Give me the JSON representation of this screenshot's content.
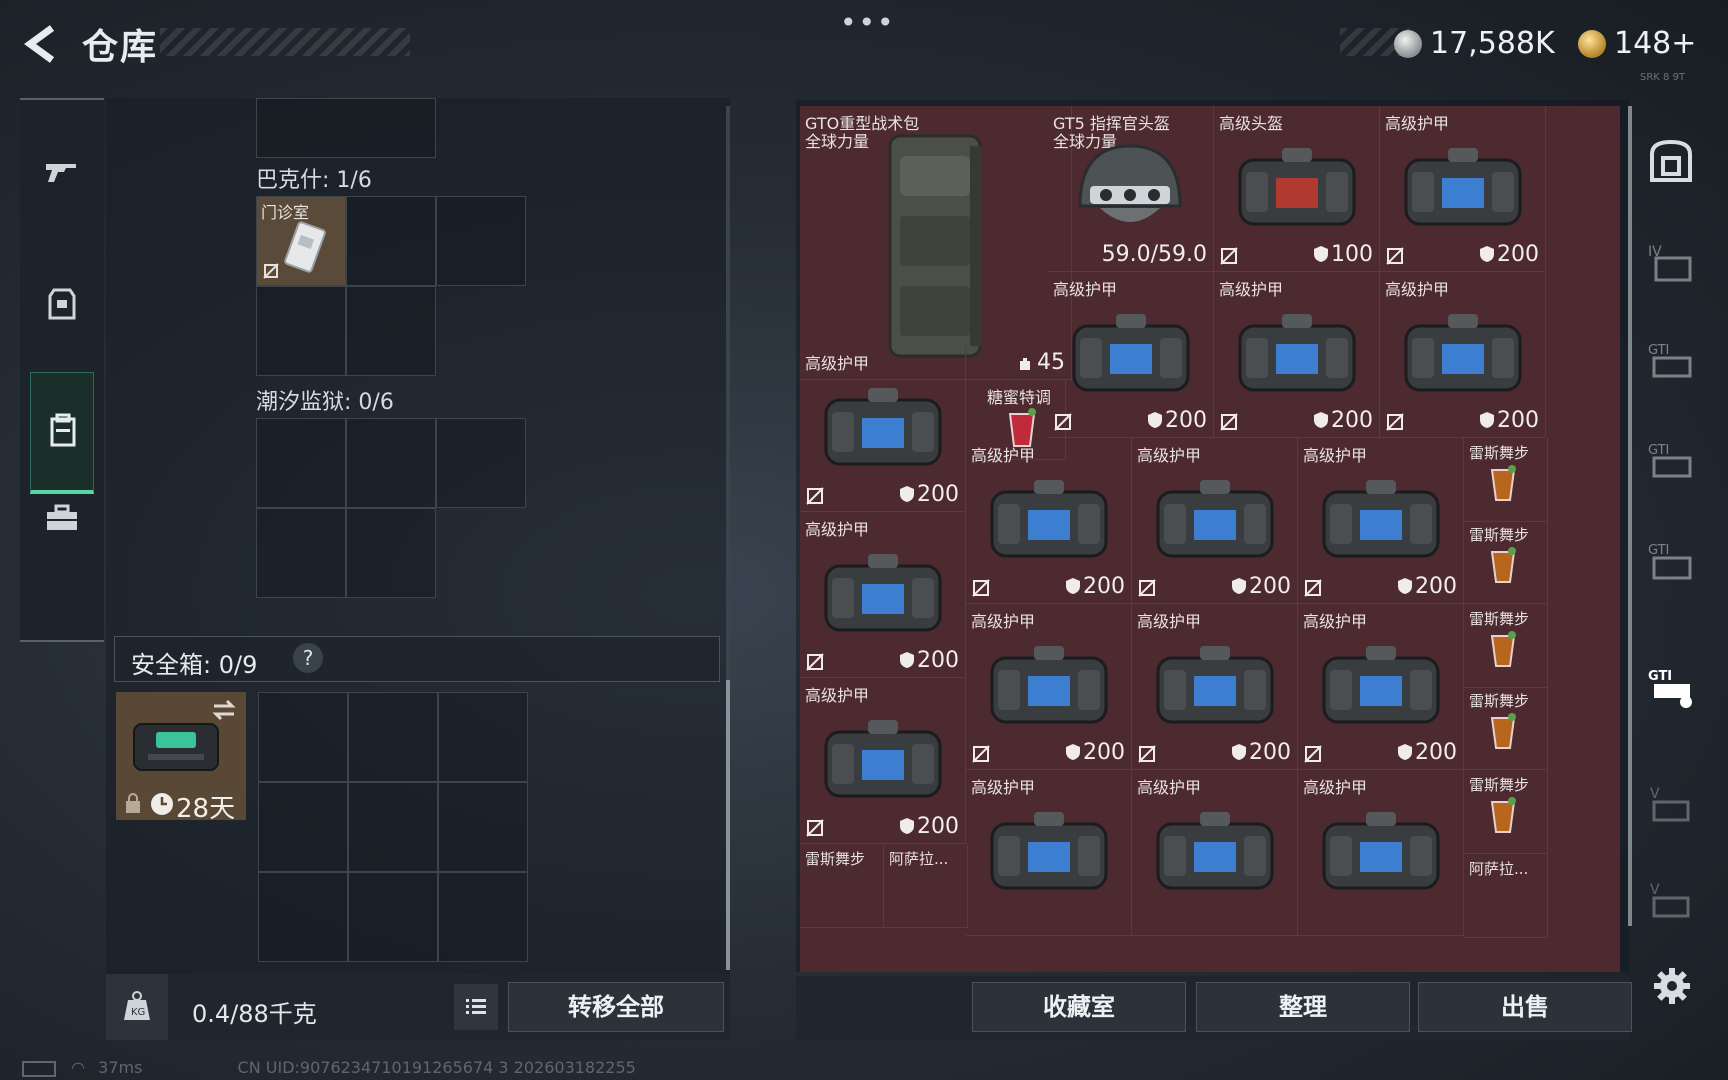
{
  "header": {
    "title": "仓库",
    "more": "•••",
    "currency_silver": "17,588K",
    "currency_gold": "148+",
    "build_tag": "SRK 8 9T"
  },
  "left_nav": {
    "items": [
      "weapons",
      "armor",
      "backpack-storage",
      "toolbox"
    ],
    "active": "backpack-storage"
  },
  "stash": {
    "section_bakshi": "巴克什: 1/6",
    "clinic_item": "门诊室",
    "section_tide_prison": "潮汐监狱: 0/6",
    "safebox_label": "安全箱: 0/9",
    "safebox_help": "?",
    "safebox_days": "28天"
  },
  "bottom_left": {
    "weight": "0.4/88千克",
    "transfer_all": "转移全部"
  },
  "inventory": {
    "items": [
      {
        "name": "GTO重型战术包",
        "sub": "全球力量",
        "value": "45"
      },
      {
        "name": "GT5 指挥官头盔",
        "sub": "全球力量",
        "value": "59.0/59.0"
      },
      {
        "name": "高级头盔",
        "value": "100"
      },
      {
        "name": "高级护甲",
        "value": "200"
      },
      {
        "name": "糖蜜特调"
      },
      {
        "name": "雷斯舞步"
      },
      {
        "name": "阿萨拉..."
      }
    ],
    "armor_label": "高级护甲",
    "armor_value": "200"
  },
  "bottom_right": {
    "collection": "收藏室",
    "organize": "整理",
    "sell": "出售"
  },
  "status": {
    "ping": "37ms",
    "uid": "CN UID:9076234710191265674 3 202603182255"
  }
}
